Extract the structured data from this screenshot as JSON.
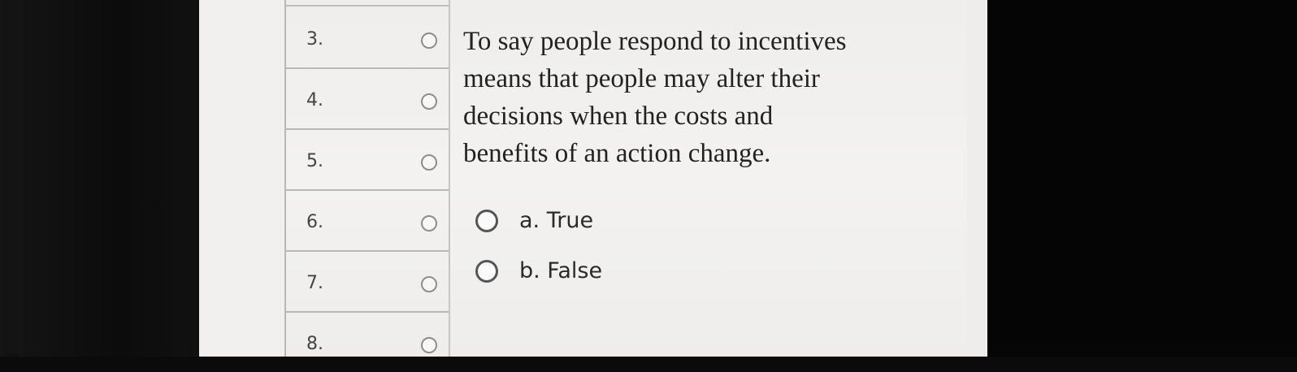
{
  "nav": {
    "items": [
      {
        "label": "3."
      },
      {
        "label": "4."
      },
      {
        "label": "5."
      },
      {
        "label": "6."
      },
      {
        "label": "7."
      },
      {
        "label": "8."
      }
    ]
  },
  "question": {
    "text_lines": [
      "To say people respond to incentives",
      "means that people may alter their",
      "decisions when the costs and",
      "benefits of an action change."
    ],
    "answers": [
      {
        "label": "a. True"
      },
      {
        "label": "b. False"
      }
    ]
  }
}
